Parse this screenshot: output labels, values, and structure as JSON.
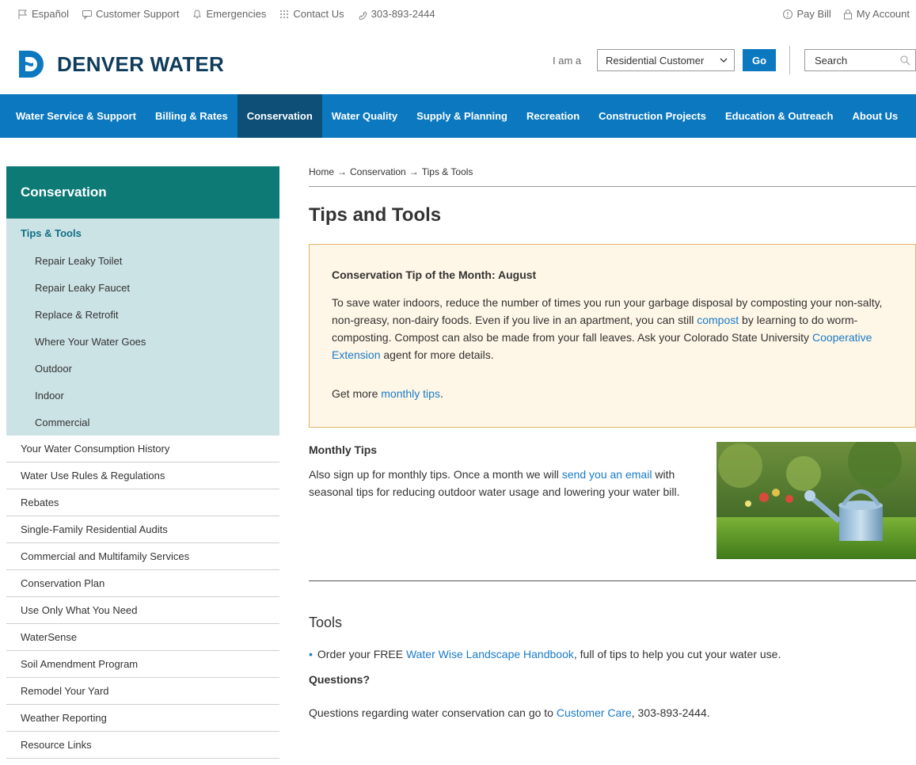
{
  "utility": {
    "left": [
      {
        "icon": "flag-icon",
        "label": "Español"
      },
      {
        "icon": "chat-icon",
        "label": "Customer Support"
      },
      {
        "icon": "bell-icon",
        "label": "Emergencies"
      },
      {
        "icon": "grid-icon",
        "label": "Contact Us"
      },
      {
        "icon": "phone-icon",
        "label": "303-893-2444"
      }
    ],
    "right": [
      {
        "icon": "dollar-icon",
        "label": "Pay Bill"
      },
      {
        "icon": "lock-icon",
        "label": "My Account"
      }
    ]
  },
  "header": {
    "brand": "DENVER WATER",
    "i_am_label": "I am a",
    "selected_role": "Residential Customer",
    "go_label": "Go",
    "search_placeholder": "Search"
  },
  "nav": [
    "Water Service & Support",
    "Billing & Rates",
    "Conservation",
    "Water Quality",
    "Supply & Planning",
    "Recreation",
    "Construction Projects",
    "Education & Outreach",
    "About Us"
  ],
  "nav_active": "Conservation",
  "sidebar": {
    "title": "Conservation",
    "current": "Tips & Tools",
    "children": [
      "Repair Leaky Toilet",
      "Repair Leaky Faucet",
      "Replace & Retrofit",
      "Where Your Water Goes",
      "Outdoor",
      "Indoor",
      "Commercial"
    ],
    "items": [
      "Your Water Consumption History",
      "Water Use Rules & Regulations",
      "Rebates",
      "Single-Family Residential Audits",
      "Commercial and Multifamily Services",
      "Conservation Plan",
      "Use Only What You Need",
      "WaterSense",
      "Soil Amendment Program",
      "Remodel Your Yard",
      "Weather Reporting",
      "Resource Links"
    ]
  },
  "content": {
    "breadcrumb": [
      "Home",
      "Conservation",
      "Tips & Tools"
    ],
    "breadcrumb_separator": "→",
    "title": "Tips and Tools",
    "tip": {
      "title": "Conservation Tip of the Month: August",
      "p1": "To save water indoors, reduce the number of times you run your garbage disposal by composting your non-salty, non-greasy, non-dairy foods. Even if you live in an apartment, you can still",
      "link_compost": "compost",
      "p2": "by learning to do worm-composting. Compost can also be made from your fall leaves. Ask your Colorado State University",
      "link_extension": "Cooperative Extension",
      "p3": "agent for more details.",
      "more_prefix": "Get more",
      "more_link": "monthly tips",
      "more_suffix": "."
    },
    "monthly": {
      "title": "Monthly Tips",
      "text1": "Also sign up for monthly tips. Once a month we will",
      "link": "send you an email",
      "text2": "with seasonal tips for reducing outdoor water usage and lowering your water bill."
    },
    "tools": {
      "title": "Tools",
      "bullet_prefix": "Order your FREE",
      "bullet_link": "Water Wise Landscape Handbook",
      "bullet_suffix": ", full of tips to help you cut your water use."
    },
    "questions": {
      "title": "Questions?",
      "prefix": "Questions regarding water conservation can go to",
      "link": "Customer Care",
      "suffix": ", 303-893-2444."
    }
  },
  "colors": {
    "nav_blue": "#0b78bf",
    "nav_active": "#0d4f76",
    "sidebar_head": "#0e7a76",
    "sidebar_sub": "#cce3e6",
    "tip_bg": "#fef6e6",
    "tip_border": "#e2b36b",
    "link": "#1a7bc8"
  }
}
